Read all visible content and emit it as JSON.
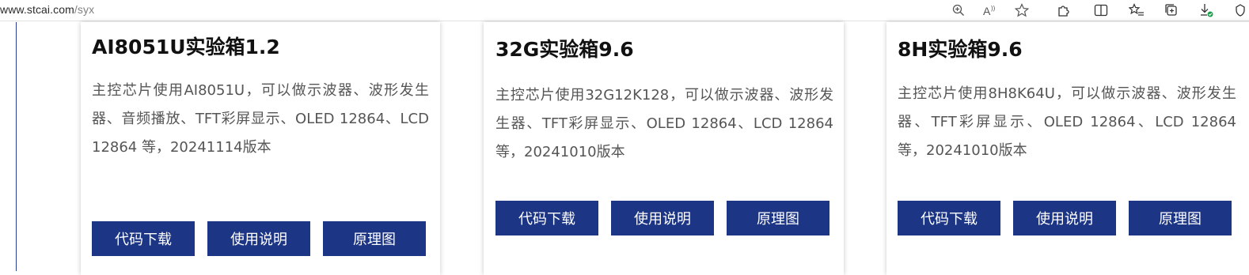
{
  "browser": {
    "url_host": "www.stcai.com",
    "url_path": "/syx",
    "toolbar_icons": [
      "zoom-icon",
      "read-aloud-icon",
      "favorite-star-icon",
      "extensions-icon",
      "split-screen-icon",
      "favorites-list-icon",
      "collections-icon",
      "downloads-icon",
      "browser-essentials-icon"
    ]
  },
  "cards": [
    {
      "title": "AI8051U实验箱1.2",
      "description": "主控芯片使用AI8051U，可以做示波器、波形发生器、音频播放、TFT彩屏显示、OLED 12864、LCD 12864 等，20241114版本",
      "buttons": [
        "代码下载",
        "使用说明",
        "原理图"
      ]
    },
    {
      "title": "32G实验箱9.6",
      "description": "主控芯片使用32G12K128，可以做示波器、波形发生器、TFT彩屏显示、OLED 12864、LCD 12864 等，20241010版本",
      "buttons": [
        "代码下载",
        "使用说明",
        "原理图"
      ]
    },
    {
      "title": "8H实验箱9.6",
      "description": "主控芯片使用8H8K64U，可以做示波器、波形发生器、TFT彩屏显示、OLED 12864、LCD 12864 等，20241010版本",
      "buttons": [
        "代码下载",
        "使用说明",
        "原理图"
      ]
    }
  ]
}
